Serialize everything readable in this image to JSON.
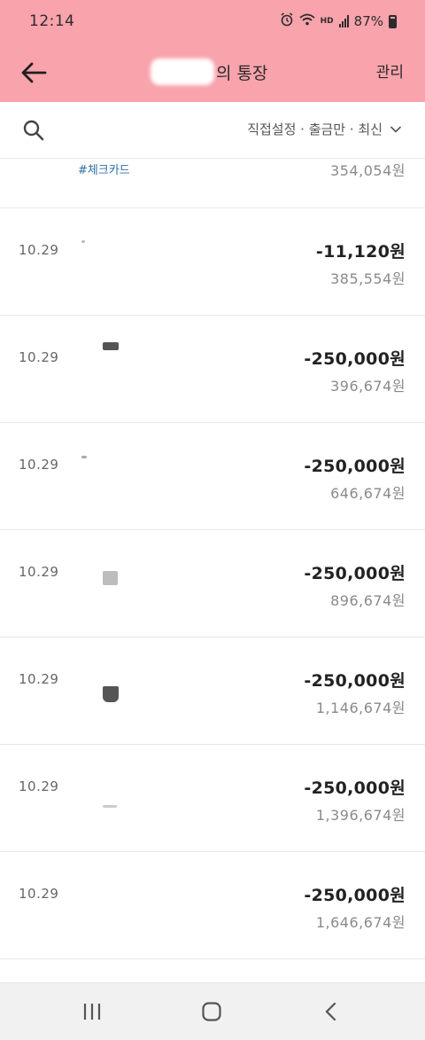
{
  "status": {
    "time": "12:14",
    "battery": "87%",
    "hd_label": "HD"
  },
  "header": {
    "title": "의 통장",
    "manage_label": "관리",
    "back_icon": "arrow-left-icon"
  },
  "filter": {
    "label": "직접설정 · 출금만 · 최신",
    "search_icon": "search-icon",
    "chevron_icon": "chevron-down-icon"
  },
  "partial_row": {
    "tag": "#체크카드",
    "balance": "354,054원"
  },
  "transactions": [
    {
      "date": "10.29",
      "amount": "-11,120원",
      "balance": "385,554원"
    },
    {
      "date": "10.29",
      "amount": "-250,000원",
      "balance": "396,674원"
    },
    {
      "date": "10.29",
      "amount": "-250,000원",
      "balance": "646,674원"
    },
    {
      "date": "10.29",
      "amount": "-250,000원",
      "balance": "896,674원"
    },
    {
      "date": "10.29",
      "amount": "-250,000원",
      "balance": "1,146,674원"
    },
    {
      "date": "10.29",
      "amount": "-250,000원",
      "balance": "1,396,674원"
    },
    {
      "date": "10.29",
      "amount": "-250,000원",
      "balance": "1,646,674원"
    }
  ],
  "nav": {
    "recents_icon": "recent-apps-icon",
    "home_icon": "home-icon",
    "back_icon": "back-chevron-icon"
  },
  "colors": {
    "header_bg": "#f9a3ad",
    "tag_color": "#2f6fa8",
    "balance_color": "#8a8a8a"
  }
}
